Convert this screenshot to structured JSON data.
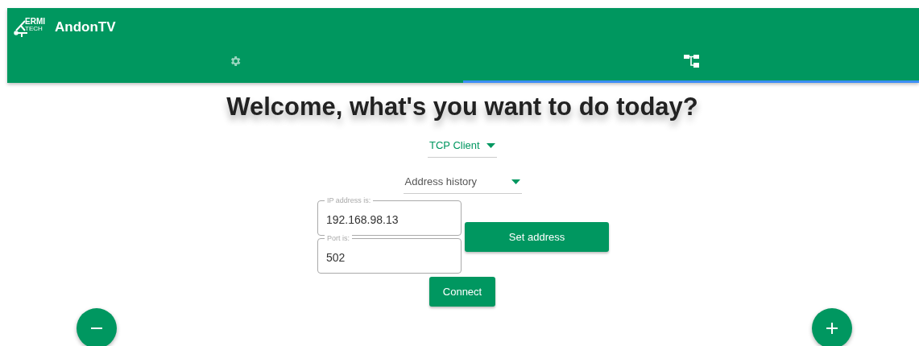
{
  "app_bar": {
    "logo": {
      "line_1": "ERMI",
      "line_2": "TECH"
    },
    "title": "AndonTV"
  },
  "tabs": [
    {
      "kind": "settings",
      "selected": false
    },
    {
      "kind": "tree",
      "selected": true
    }
  ],
  "heading": "Welcome, what's you want to do today?",
  "mode_dropdown": {
    "value": "TCP Client"
  },
  "history_dropdown": {
    "placeholder": "Address history"
  },
  "ip_field": {
    "label": "IP address is:",
    "value": "192.168.98.13"
  },
  "port_field": {
    "label": "Port is:",
    "value": "502"
  },
  "set_button": "Set address",
  "connect_button": "Connect",
  "fabs": [
    {
      "kind": "minus"
    },
    {
      "kind": "plus"
    }
  ]
}
